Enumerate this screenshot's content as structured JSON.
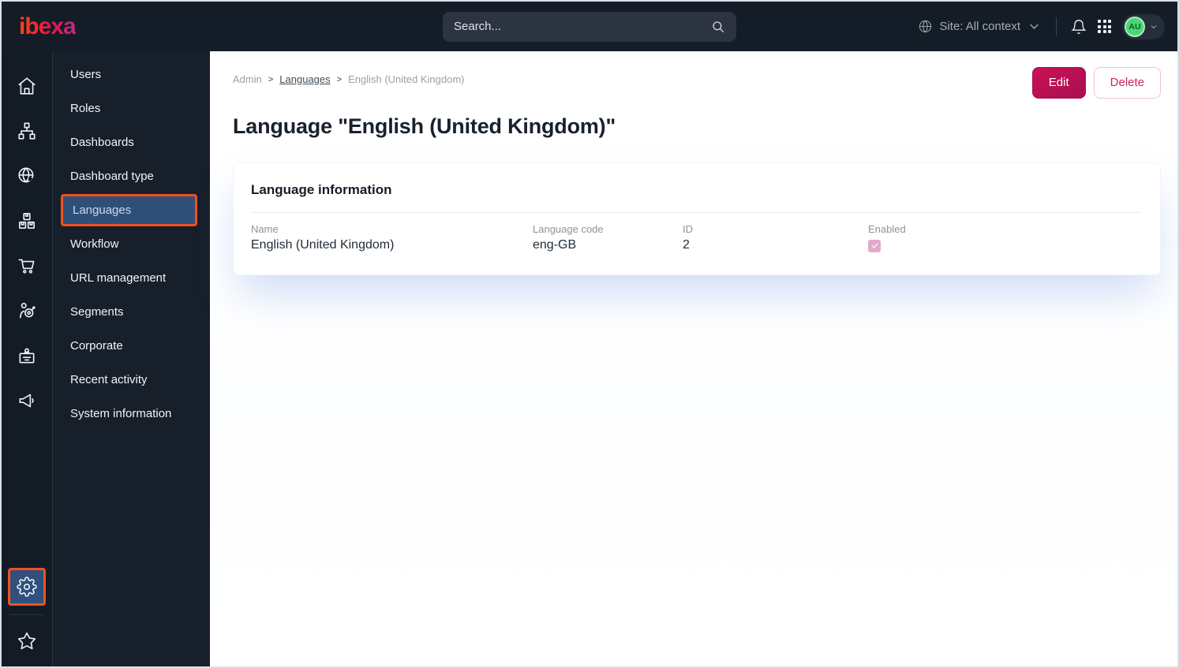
{
  "topbar": {
    "logo_text": "ibexa",
    "search": {
      "placeholder": "Search..."
    },
    "site_context_label": "Site: All context",
    "avatar_initials": "AU",
    "icons": [
      "globe-icon",
      "chevron-down-icon",
      "bell-icon",
      "app-grid-icon",
      "search-icon"
    ]
  },
  "icon_rail": {
    "icons": [
      "home-icon",
      "sitemap-icon",
      "globe-cursor-icon",
      "product-boxes-icon",
      "cart-icon",
      "personalization-icon",
      "corporate-badge-icon",
      "megaphone-icon"
    ],
    "bottom_icons": [
      "gear-icon",
      "star-icon"
    ],
    "active_icon": "gear-icon",
    "active_highlight_color": "#f4511e"
  },
  "sidebar": {
    "items": [
      {
        "label": "Users",
        "active": false
      },
      {
        "label": "Roles",
        "active": false
      },
      {
        "label": "Dashboards",
        "active": false
      },
      {
        "label": "Dashboard type",
        "active": false
      },
      {
        "label": "Languages",
        "active": true
      },
      {
        "label": "Workflow",
        "active": false
      },
      {
        "label": "URL management",
        "active": false
      },
      {
        "label": "Segments",
        "active": false
      },
      {
        "label": "Corporate",
        "active": false
      },
      {
        "label": "Recent activity",
        "active": false
      },
      {
        "label": "System information",
        "active": false
      }
    ],
    "selected_bg": "#2e5078",
    "selected_border": "#f4511e"
  },
  "breadcrumb": {
    "items": [
      "Admin",
      "Languages",
      "English (United Kingdom)"
    ],
    "separator": ">"
  },
  "actions": {
    "edit_label": "Edit",
    "delete_label": "Delete"
  },
  "page": {
    "title": "Language \"English (United Kingdom)\""
  },
  "card": {
    "title": "Language information",
    "enabled_checked": true,
    "fields": [
      {
        "label": "Name",
        "value": "English (United Kingdom)"
      },
      {
        "label": "Language code",
        "value": "eng-GB"
      },
      {
        "label": "ID",
        "value": "2"
      },
      {
        "label": "Enabled",
        "value": "checked"
      }
    ]
  },
  "colors": {
    "topbar_bg": "#141d27",
    "accent_orange": "#f4511e",
    "primary_button": "#bd0f52",
    "selected_blue": "#2e5078",
    "avatar_green": "#4cd673",
    "checkbox_pink": "#e5a9cb"
  }
}
